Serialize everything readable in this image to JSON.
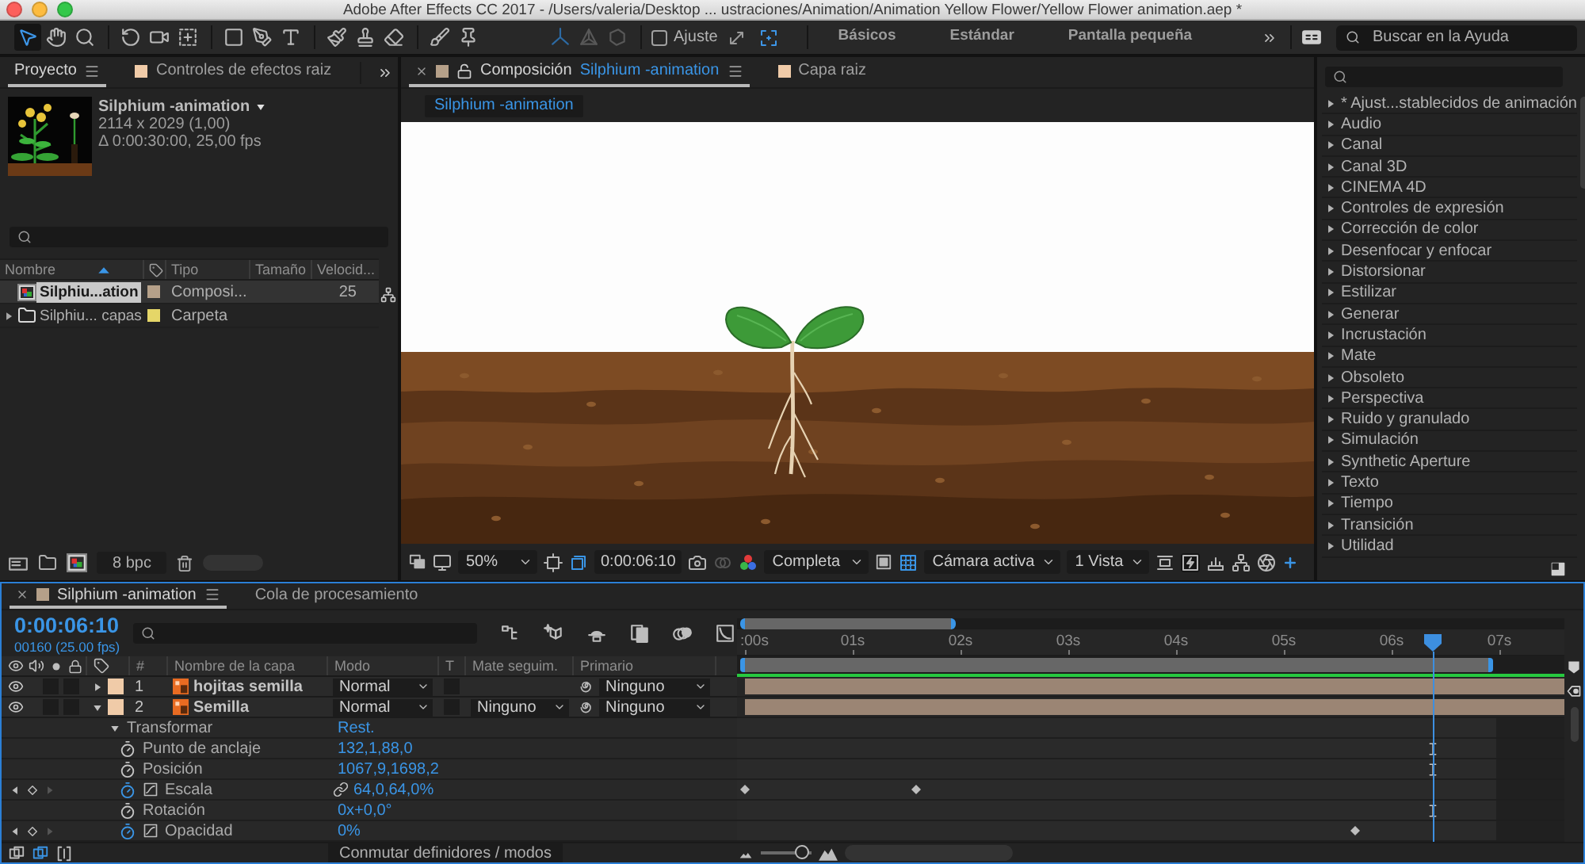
{
  "title_bar": {
    "title": "Adobe After Effects CC 2017 - /Users/valeria/Desktop ... ustraciones/Animation/Animation Yellow Flower/Yellow Flower animation.aep *"
  },
  "toolbar": {
    "tools": [
      {
        "kind": "selection",
        "selected": true
      },
      {
        "kind": "hand",
        "selected": false
      },
      {
        "kind": "zoom",
        "selected": false
      },
      {
        "kind": "rotate",
        "selected": false
      },
      {
        "kind": "camera",
        "selected": false
      },
      {
        "kind": "pan_behind",
        "selected": false
      },
      {
        "kind": "rectangle",
        "selected": false
      },
      {
        "kind": "pen",
        "selected": false
      },
      {
        "kind": "text",
        "selected": false
      },
      {
        "kind": "brush",
        "selected": false
      },
      {
        "kind": "stamp",
        "selected": false
      },
      {
        "kind": "eraser",
        "selected": false
      },
      {
        "kind": "roto",
        "selected": false
      },
      {
        "kind": "pin",
        "selected": false
      }
    ],
    "axis_modes": [
      {
        "kind": "local",
        "selected": true
      },
      {
        "kind": "world",
        "selected": false
      },
      {
        "kind": "view",
        "selected": false
      }
    ],
    "snapping": {
      "label": "Ajuste",
      "checked": false
    },
    "workspaces": [
      {
        "label": "Básicos",
        "selected": false
      },
      {
        "label": "Estándar",
        "selected": false
      },
      {
        "label": "Pantalla pequeña",
        "selected": false
      }
    ],
    "help_search": {
      "placeholder": "Buscar en la Ayuda"
    }
  },
  "project_panel": {
    "tabs": [
      {
        "label": "Proyecto",
        "selected": true
      },
      {
        "label": "Controles de efectos raiz",
        "selected": false,
        "color": "#f0cba8"
      }
    ],
    "selection_info": {
      "name": "Silphium -animation",
      "dimensions": "2114 x 2029 (1,00)",
      "duration": "Δ 0:00:30:00, 25,00 fps"
    },
    "columns": [
      "Nombre",
      "Tipo",
      "Tamaño",
      "Velocid..."
    ],
    "items": [
      {
        "kind": "composition",
        "name": "Silphiu...ation",
        "color": "#b5a089",
        "type": "Composi...",
        "speed": "25",
        "selected": true
      },
      {
        "kind": "folder",
        "name": "Silphiu... capas",
        "color": "#e5d668",
        "type": "Carpeta",
        "selected": false,
        "expanded": false
      }
    ],
    "bit_depth": "8 bpc"
  },
  "composition_panel": {
    "tabs": [
      {
        "label": "Composición",
        "comp_name": "Silphium -animation",
        "selected": true,
        "color": "#b5a089",
        "locked": false
      },
      {
        "label": "Capa raiz",
        "selected": false,
        "color": "#f0cba8"
      }
    ],
    "viewer_tab": "Silphium -animation",
    "viewer_toolbar": {
      "magnification": "50%",
      "timecode": "0:00:06:10",
      "resolution": "Completa",
      "camera": "Cámara activa",
      "views": "1 Vista"
    }
  },
  "effects_panel": {
    "categories": [
      {
        "label": "* Ajust...stablecidos de animación",
        "expanded": false
      },
      {
        "label": "Audio",
        "expanded": false
      },
      {
        "label": "Canal",
        "expanded": false
      },
      {
        "label": "Canal 3D",
        "expanded": false
      },
      {
        "label": "CINEMA 4D",
        "expanded": false
      },
      {
        "label": "Controles de expresión",
        "expanded": false
      },
      {
        "label": "Corrección de color",
        "expanded": false
      },
      {
        "label": "Desenfocar y enfocar",
        "expanded": false
      },
      {
        "label": "Distorsionar",
        "expanded": false
      },
      {
        "label": "Estilizar",
        "expanded": false
      },
      {
        "label": "Generar",
        "expanded": false
      },
      {
        "label": "Incrustación",
        "expanded": false
      },
      {
        "label": "Mate",
        "expanded": false
      },
      {
        "label": "Obsoleto",
        "expanded": false
      },
      {
        "label": "Perspectiva",
        "expanded": false
      },
      {
        "label": "Ruido y granulado",
        "expanded": false
      },
      {
        "label": "Simulación",
        "expanded": false
      },
      {
        "label": "Synthetic Aperture",
        "expanded": false
      },
      {
        "label": "Texto",
        "expanded": false
      },
      {
        "label": "Tiempo",
        "expanded": false
      },
      {
        "label": "Transición",
        "expanded": false
      },
      {
        "label": "Utilidad",
        "expanded": false
      }
    ]
  },
  "timeline_panel": {
    "tabs": [
      {
        "label": "Silphium -animation",
        "selected": true,
        "color": "#b5a089"
      },
      {
        "label": "Cola de procesamiento",
        "selected": false
      }
    ],
    "current_time": "0:00:06:10",
    "frame_info": "00160 (25.00 fps)",
    "columns": [
      "#",
      "Nombre de la capa",
      "Modo",
      "T",
      "Mate seguim.",
      "Primario"
    ],
    "ruler": [
      ":00s",
      "01s",
      "02s",
      "03s",
      "04s",
      "05s",
      "06s",
      "07s"
    ],
    "playhead": {
      "level": 0.841
    },
    "work_area": {
      "level": 0.918
    },
    "layers": [
      {
        "number": "1",
        "name": "hojitas semilla",
        "color": "#f0cba8",
        "visible": true,
        "solo": false,
        "locked": false,
        "preserve_transparency": false,
        "expanded": false,
        "mode": "Normal",
        "parent": "Ninguno"
      },
      {
        "number": "2",
        "name": "Semilla",
        "color": "#f0cba8",
        "visible": true,
        "solo": false,
        "locked": false,
        "preserve_transparency": false,
        "expanded": true,
        "mode": "Normal",
        "track_matte": "Ninguno",
        "parent": "Ninguno",
        "children": [
          {
            "name": "Transformar",
            "expanded": true,
            "action": "Rest.",
            "children": [
              {
                "name": "Punto de anclaje",
                "value": "132,1,88,0",
                "animated": false,
                "linked": false
              },
              {
                "name": "Posición",
                "value": "1067,9,1698,2",
                "animated": false,
                "linked": false
              },
              {
                "name": "Escala",
                "value": "64,0,64,0%",
                "animated": true,
                "linked": true,
                "keyframes": [
                  {
                    "level": 0.01
                  },
                  {
                    "level": 0.216
                  }
                ]
              },
              {
                "name": "Rotación",
                "value": "0x+0,0°",
                "animated": false,
                "linked": false
              },
              {
                "name": "Opacidad",
                "value": "0%",
                "animated": true,
                "linked": false,
                "keyframes": [
                  {
                    "level": 0.748
                  }
                ]
              }
            ]
          }
        ]
      }
    ],
    "switch_toggle": "Conmutar definidores / modos",
    "zoom_slider": {
      "level": 0.8
    }
  }
}
